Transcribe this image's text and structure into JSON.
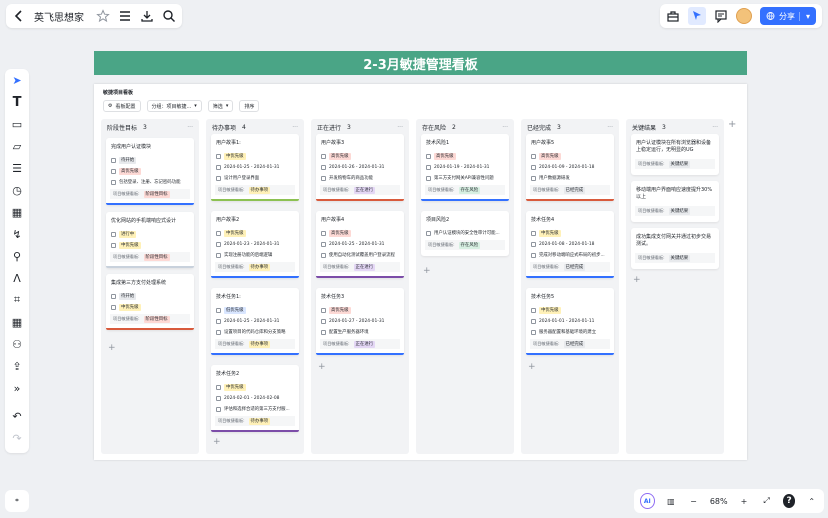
{
  "app": {
    "title": "英飞思想家"
  },
  "share_label": "分享",
  "zoom": "68%",
  "banner": "2-3月敏捷管理看板",
  "board": {
    "title": "敏捷项目看板",
    "config": "看板配置",
    "group": "分组：项目敏捷...",
    "filter": "筛选",
    "sort": "排序"
  },
  "colors": {
    "accent": "#3370ff",
    "banner": "#4aa586"
  },
  "columns": [
    {
      "name": "阶段性目标",
      "count": "3",
      "cards": [
        {
          "title": "完成用户认证模块",
          "bar": "#3370ff",
          "rows": [
            [
              "待开始",
              "#e8eaed"
            ],
            [
              "高优先级",
              "#fdd9d5"
            ],
            [
              "包括登录、注册、忘记密码功能",
              ""
            ]
          ],
          "foot_label": "项目敏捷看板:",
          "foot_tag": "阶段性目标",
          "foot_color": "#fdd9d5"
        },
        {
          "title": "优化网站的手机端响应式设计",
          "bar": "#c8d1dc",
          "rows": [
            [
              "进行中",
              "#fff1b8"
            ],
            [
              "中优先级",
              "#fff1b8"
            ]
          ],
          "foot_label": "项目敏捷看板:",
          "foot_tag": "阶段性目标",
          "foot_color": "#fdd9d5"
        },
        {
          "title": "集成第三方支付处理系统",
          "bar": "#d85a3c",
          "rows": [
            [
              "待开始",
              "#e8eaed"
            ],
            [
              "中优先级",
              "#fff1b8"
            ]
          ],
          "foot_label": "项目敏捷看板:",
          "foot_tag": "阶段性目标",
          "foot_color": "#fdd9d5"
        }
      ]
    },
    {
      "name": "待办事项",
      "count": "4",
      "cards": [
        {
          "title": "用户故事1:",
          "bar": "#8cc152",
          "rows": [
            [
              "中优先级",
              "#fff1b8"
            ],
            [
              "2024-01-25 - 2024-01-31",
              ""
            ],
            [
              "设计用户登录界面",
              ""
            ]
          ],
          "foot_label": "项目敏捷看板:",
          "foot_tag": "待办事项",
          "foot_color": "#fff1b8"
        },
        {
          "title": "用户故事2",
          "bar": "#3370ff",
          "rows": [
            [
              "中优先级",
              "#fff1b8"
            ],
            [
              "2024-01-23 - 2024-01-31",
              ""
            ],
            [
              "实现注册功能的后端逻辑",
              ""
            ]
          ],
          "foot_label": "项目敏捷看板:",
          "foot_tag": "待办事项",
          "foot_color": "#fff1b8"
        },
        {
          "title": "技术任务1:",
          "bar": "#3370ff",
          "rows": [
            [
              "低优先级",
              "#d9e6ff"
            ],
            [
              "2024-01-25 - 2024-01-31",
              ""
            ],
            [
              "设置项目的代码仓库和分支策略",
              ""
            ]
          ],
          "foot_label": "项目敏捷看板:",
          "foot_tag": "待办事项",
          "foot_color": "#fff1b8"
        },
        {
          "title": "技术任务2",
          "bar": "#7c4da8",
          "rows": [
            [
              "中优先级",
              "#fff1b8"
            ],
            [
              "2024-02-01 - 2024-02-08",
              ""
            ],
            [
              "评估和选择合适的第三方支付服...",
              ""
            ]
          ],
          "foot_label": "项目敏捷看板:",
          "foot_tag": "待办事项",
          "foot_color": "#fff1b8"
        }
      ]
    },
    {
      "name": "正在进行",
      "count": "3",
      "cards": [
        {
          "title": "用户故事3",
          "bar": "#d85a3c",
          "rows": [
            [
              "高优先级",
              "#fdd9d5"
            ],
            [
              "2024-01-26 - 2024-01-31",
              ""
            ],
            [
              "开发购物车的商品功能",
              ""
            ]
          ],
          "foot_label": "项目敏捷看板:",
          "foot_tag": "正在进行",
          "foot_color": "#e4d7f5"
        },
        {
          "title": "用户故事4",
          "bar": "#7c4da8",
          "rows": [
            [
              "高优先级",
              "#fdd9d5"
            ],
            [
              "2024-01-25 - 2024-01-31",
              ""
            ],
            [
              "使用自动化测试覆盖用户登录流程",
              ""
            ]
          ],
          "foot_label": "项目敏捷看板:",
          "foot_tag": "正在进行",
          "foot_color": "#e4d7f5"
        },
        {
          "title": "技术任务3",
          "bar": "#3370ff",
          "rows": [
            [
              "高优先级",
              "#fdd9d5"
            ],
            [
              "2024-01-27 - 2024-01-31",
              ""
            ],
            [
              "配置生产服务器环境",
              ""
            ]
          ],
          "foot_label": "项目敏捷看板:",
          "foot_tag": "正在进行",
          "foot_color": "#e4d7f5"
        }
      ]
    },
    {
      "name": "存在风险",
      "count": "2",
      "cards": [
        {
          "title": "技术风险1",
          "bar": "#3370ff",
          "rows": [
            [
              "高优先级",
              "#fdd9d5"
            ],
            [
              "2024-01-19 - 2024-01-31",
              ""
            ],
            [
              "第三方支付网关API兼容性问题",
              ""
            ]
          ],
          "foot_label": "项目敏捷看板:",
          "foot_tag": "存在风险",
          "foot_color": "#d7f0e2"
        },
        {
          "title": "项目风险2",
          "bar": "",
          "rows": [
            [
              "用户认证模块的安全性审计可能...",
              ""
            ]
          ],
          "foot_label": "项目敏捷看板:",
          "foot_tag": "存在风险",
          "foot_color": "#d7f0e2"
        }
      ]
    },
    {
      "name": "已经完成",
      "count": "3",
      "cards": [
        {
          "title": "用户故事5",
          "bar": "#d85a3c",
          "rows": [
            [
              "高优先级",
              "#fdd9d5"
            ],
            [
              "2024-01-09 - 2024-01-18",
              ""
            ],
            [
              "用户数据源研发",
              ""
            ]
          ],
          "foot_label": "项目敏捷看板:",
          "foot_tag": "已经完成",
          "foot_color": "#e8eaed"
        },
        {
          "title": "技术任务4",
          "bar": "#3370ff",
          "rows": [
            [
              "中优先级",
              "#fff1b8"
            ],
            [
              "2024-01-08 - 2024-01-18",
              ""
            ],
            [
              "完成对移动端响应式布局的初步...",
              ""
            ]
          ],
          "foot_label": "项目敏捷看板:",
          "foot_tag": "已经完成",
          "foot_color": "#e8eaed"
        },
        {
          "title": "技术任务5",
          "bar": "#3370ff",
          "rows": [
            [
              "中优先级",
              "#fff1b8"
            ],
            [
              "2024-01-01 - 2024-01-11",
              ""
            ],
            [
              "服务器配置和基础环境的建立",
              ""
            ]
          ],
          "foot_label": "项目敏捷看板:",
          "foot_tag": "已经完成",
          "foot_color": "#e8eaed"
        }
      ]
    },
    {
      "name": "关键结果",
      "count": "3",
      "cards": [
        {
          "title": "用户认证模块在所有浏览器和设备上稳定运行，无明显的UG",
          "bar": "",
          "rows": [],
          "foot_label": "项目敏捷看板:",
          "foot_tag": "关键结果",
          "foot_color": "#e8eaed"
        },
        {
          "title": "移动端用户界面响应速度提升30%以上",
          "bar": "",
          "rows": [],
          "foot_label": "项目敏捷看板:",
          "foot_tag": "关键结果",
          "foot_color": "#e8eaed"
        },
        {
          "title": "成功集成支付网关并通过初步交易测试。",
          "bar": "",
          "rows": [],
          "foot_label": "项目敏捷看板:",
          "foot_tag": "关键结果",
          "foot_color": "#e8eaed"
        }
      ]
    }
  ]
}
